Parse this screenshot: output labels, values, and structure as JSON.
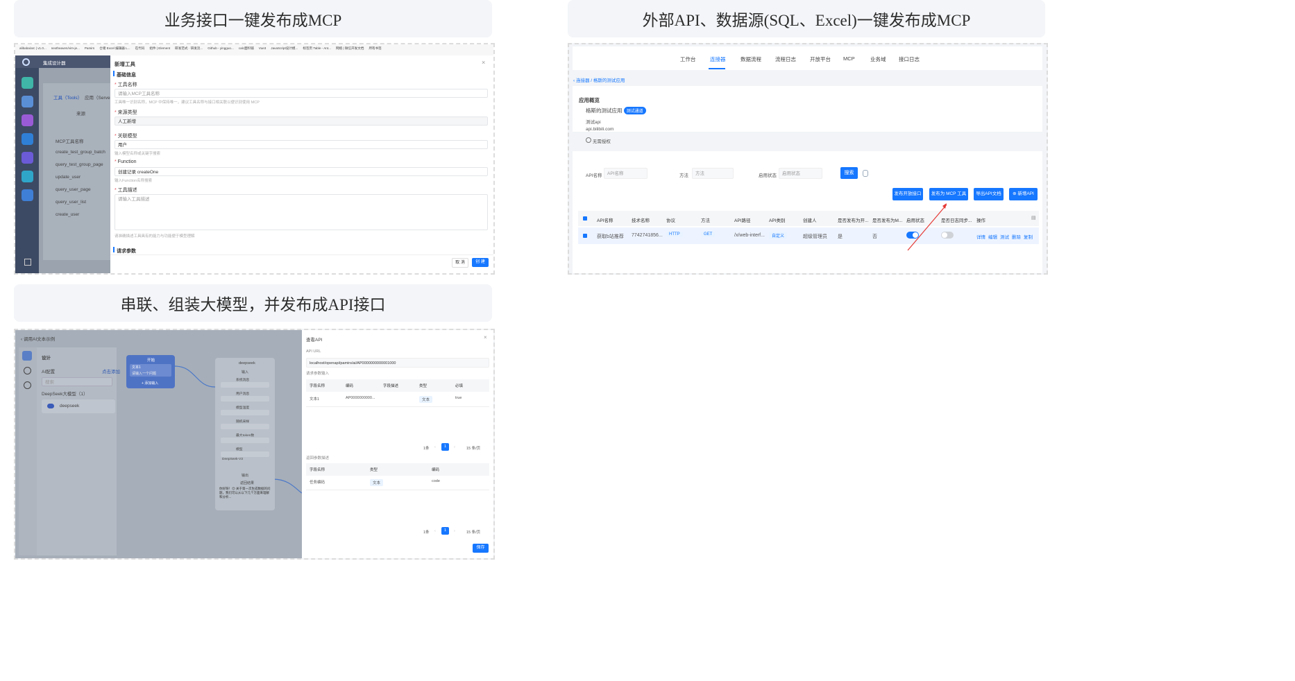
{
  "headers": {
    "top_left": "业务接口一键发布成MCP",
    "top_right": "外部API、数据源(SQL、Excel)一键发布成MCP",
    "bottom_left": "串联、组装大模型，并发布成API接口"
  },
  "panel1": {
    "bookmarks": [
      "alibaba/arc | v1.0...",
      "nextheaven/vim-je...",
      "Pamirs",
      "仓储 Excel 编辑器 L...",
      "在代码",
      "组件 | Element",
      "研发范式 · 研发流...",
      "Github - yingguo...",
      "calc面料铺",
      "Vue3",
      "JavaScript设计模...",
      "标签页 Table - Ant...",
      "网络 | 微信开发文档",
      "所有书签"
    ],
    "app_title": "集成设计器",
    "tabs": [
      "工具（Tools）",
      "应用（Server）"
    ],
    "sub_tab": "来源",
    "list_header": "MCP工具名称",
    "list_items": [
      "create_test_group_batch",
      "query_test_group_page",
      "update_user",
      "query_user_page",
      "query_user_list",
      "create_user"
    ],
    "dialog_title": "新增工具",
    "section_basic": "基础信息",
    "field_tool_name": "工具名称",
    "field_tool_name_ph": "请输入MCP工具名称",
    "field_tool_name_hint": "工具唯一识别名称，MCP 中保持唯一，建议工具名称与接口相关联以便识别使用 MCP",
    "field_source": "来源类型",
    "field_source_val": "人工新增",
    "field_model": "关联模型",
    "field_model_val": "用户",
    "field_model_hint": "输入模型名称或关键字搜索",
    "field_function": "Function",
    "field_function_val": "创建记录 createOne",
    "field_function_hint": "输入Function名称搜索",
    "field_desc": "工具描述",
    "field_desc_ph": "请输入工具描述",
    "field_desc_hint": "请准确描述工具具有的能力与功能便于模型理解",
    "section_params": "请求参数",
    "btn_cancel": "取 消",
    "btn_create": "创 建"
  },
  "panel2": {
    "nav": [
      "工作台",
      "连接器",
      "数据流程",
      "流程日志",
      "开放平台",
      "MCP",
      "业务域",
      "接口日志"
    ],
    "nav_active": "连接器",
    "breadcrumb": "连接器 / 格斯的测试应用",
    "overview_title": "应用概览",
    "app_name": "格斯的测试应用",
    "app_badge": "测试通道",
    "app_desc": "测试api",
    "app_domain": "api.bilibili.com",
    "app_auth": "无需授权",
    "filter_name_label": "API名称",
    "filter_name_ph": "API名称",
    "filter_method_label": "方法",
    "filter_method_ph": "方法",
    "filter_status_label": "启用状态",
    "filter_status_ph": "启用状态",
    "btn_search": "搜索",
    "btn_publish_open": "发布开放接口",
    "btn_publish_mcp": "发布为 MCP 工具",
    "btn_export": "导出API文档",
    "btn_add": "新增API",
    "columns": [
      "API名称",
      "技术名称",
      "协议",
      "方法",
      "API路径",
      "API类别",
      "创建人",
      "是否发布为开...",
      "是否发布为M...",
      "启用状态",
      "是否日志同步...",
      "操作"
    ],
    "row": {
      "name": "获取b站推荐",
      "tech": "7742741856...",
      "protocol": "HTTP",
      "method": "GET",
      "path": "/x/web-interf...",
      "category": "自定义",
      "creator": "超级管理员",
      "pub_open": "是",
      "pub_mcp": "否",
      "enabled": true,
      "log_sync": false,
      "actions": [
        "详情",
        "编辑",
        "测试",
        "删除",
        "复制"
      ]
    }
  },
  "panel3": {
    "back_title": "调用AI文本示例",
    "design_label": "设计",
    "ai_config_label": "AI配置",
    "ai_config_add": "点击添加",
    "search_ph": "搜索",
    "model_group": "DeepSeek大模型（1）",
    "model_item": "deepseek",
    "node_start": "开始",
    "node_start_field": "文本1",
    "node_start_hint": "请输入一个问题",
    "node_start_add": "+ 添加输入",
    "node_ds_title": "deepseek",
    "node_ds_input": "输入",
    "node_ds_fields": [
      "系统消息",
      "用户消息",
      "模型温度",
      "随机采样",
      "最大token数",
      "模型"
    ],
    "node_ds_model_val": "DeepSeek-V3",
    "node_ds_output": "输出",
    "node_ds_result": "返回结果",
    "node_ds_text": "你好呀！😊 关于第一次生成数据的问题，我们可以从以下几个方面来理解和分析...",
    "drawer_title": "查看API",
    "api_url_label": "API URL",
    "api_url": "localhost/openapi/pamirs/ai/AP0000000000001000",
    "input_section": "请求参数输入",
    "input_cols": [
      "字段名称",
      "编码",
      "字段描述",
      "类型",
      "必填"
    ],
    "input_row": [
      "文本1",
      "AP0000000000...",
      "",
      "文本",
      "true"
    ],
    "pager_total": "1条",
    "pager_page": "1",
    "pager_size": "15 条/页",
    "output_section": "返回参数描述",
    "output_cols": [
      "字段名称",
      "类型",
      "编码"
    ],
    "output_row": [
      "任务编码",
      "文本",
      "code"
    ],
    "pager2_total": "1条",
    "pager2_page": "1",
    "pager2_size": "15 条/页",
    "btn_save": "保存"
  }
}
